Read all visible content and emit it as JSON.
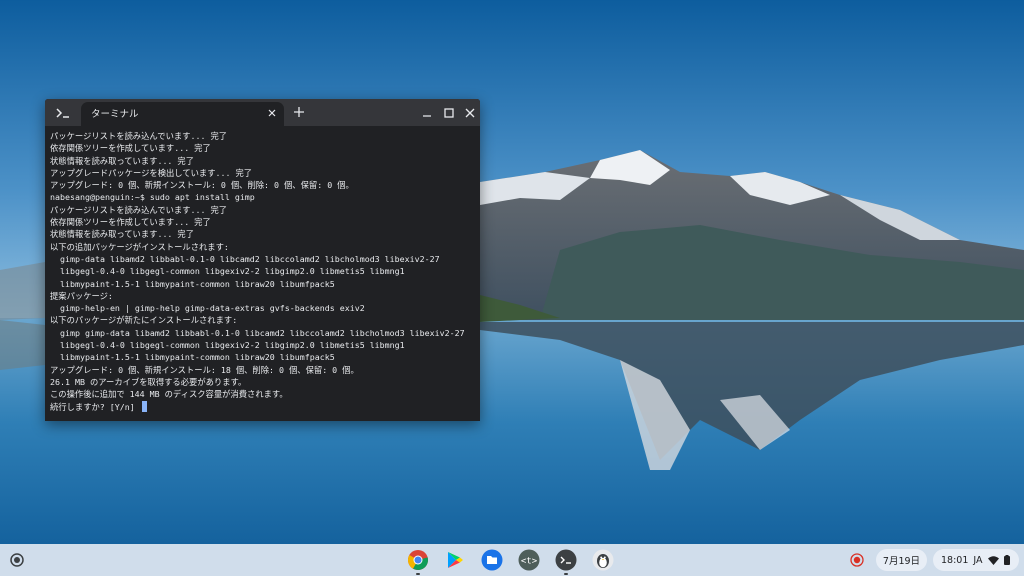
{
  "terminal": {
    "tab_label": "ターミナル",
    "lines": [
      "パッケージリストを読み込んでいます... 完了",
      "依存関係ツリーを作成しています... 完了",
      "状態情報を読み取っています... 完了",
      "アップグレードパッケージを検出しています... 完了",
      "アップグレード: 0 個、新規インストール: 0 個、削除: 0 個、保留: 0 個。",
      "nabesang@penguin:~$ sudo apt install gimp",
      "パッケージリストを読み込んでいます... 完了",
      "依存関係ツリーを作成しています... 完了",
      "状態情報を読み取っています... 完了",
      "以下の追加パッケージがインストールされます:",
      "  gimp-data libamd2 libbabl-0.1-0 libcamd2 libccolamd2 libcholmod3 libexiv2-27",
      "  libgegl-0.4-0 libgegl-common libgexiv2-2 libgimp2.0 libmetis5 libmng1",
      "  libmypaint-1.5-1 libmypaint-common libraw20 libumfpack5",
      "提案パッケージ:",
      "  gimp-help-en | gimp-help gimp-data-extras gvfs-backends exiv2",
      "以下のパッケージが新たにインストールされます:",
      "  gimp gimp-data libamd2 libbabl-0.1-0 libcamd2 libccolamd2 libcholmod3 libexiv2-27",
      "  libgegl-0.4-0 libgegl-common libgexiv2-2 libgimp2.0 libmetis5 libmng1",
      "  libmypaint-1.5-1 libmypaint-common libraw20 libumfpack5",
      "アップグレード: 0 個、新規インストール: 18 個、削除: 0 個、保留: 0 個。",
      "26.1 MB のアーカイブを取得する必要があります。",
      "この操作後に追加で 144 MB のディスク容量が消費されます。"
    ],
    "prompt": "続行しますか? [Y/n] "
  },
  "shelf": {
    "apps": [
      {
        "name": "chrome",
        "icon": "chrome-icon"
      },
      {
        "name": "play-store",
        "icon": "play-store-icon"
      },
      {
        "name": "files",
        "icon": "files-icon"
      },
      {
        "name": "text",
        "icon": "text-app-icon"
      },
      {
        "name": "terminal",
        "icon": "terminal-icon"
      },
      {
        "name": "linux",
        "icon": "penguin-icon"
      }
    ],
    "date": "7月19日",
    "time": "18:01",
    "ime": "JA"
  },
  "colors": {
    "terminal_bg": "#202124",
    "titlebar": "#35363a",
    "cursor": "#8ab4f8",
    "shelf": "#e1e8f2"
  }
}
